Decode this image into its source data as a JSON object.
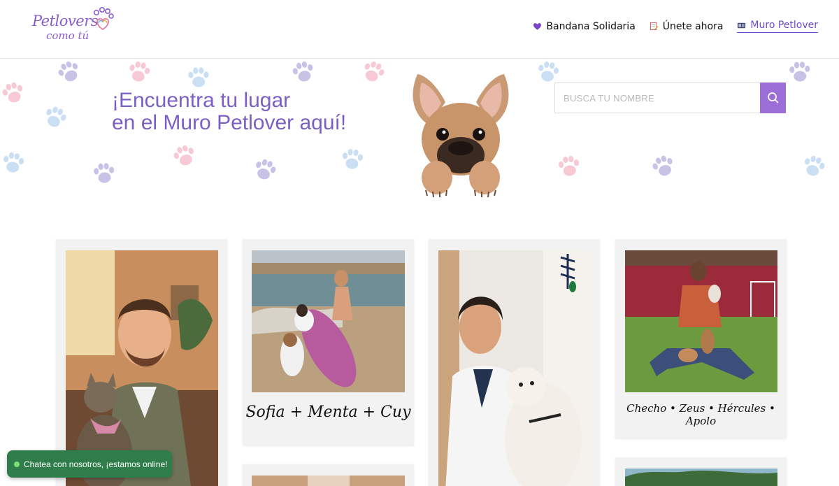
{
  "logo": {
    "line1": "Petlovers",
    "line2": "como tú"
  },
  "nav": {
    "items": [
      {
        "label": "Bandana Solidaria",
        "icon": "purple-heart-icon"
      },
      {
        "label": "Únete ahora",
        "icon": "pencil-note-icon"
      },
      {
        "label": "Muro Petlover",
        "icon": "photo-wall-icon"
      }
    ]
  },
  "hero": {
    "title": "¡Encuentra tu lugar\nen el Muro Petlover aquí!",
    "search_placeholder": "BUSCA TU NOMBRE",
    "search_icon": "search-icon"
  },
  "cards": [
    {
      "caption": ""
    },
    {
      "caption": "Sofia + Menta + Cuy"
    },
    {
      "caption": ""
    },
    {
      "caption": "Checho • Zeus • Hércules • Apolo"
    }
  ],
  "chat": {
    "label": "Chatea con nosotros, ¡estamos online!"
  },
  "colors": {
    "accent": "#9c6fd8",
    "title": "#7b5fc4",
    "chat": "#2e7d4a"
  }
}
